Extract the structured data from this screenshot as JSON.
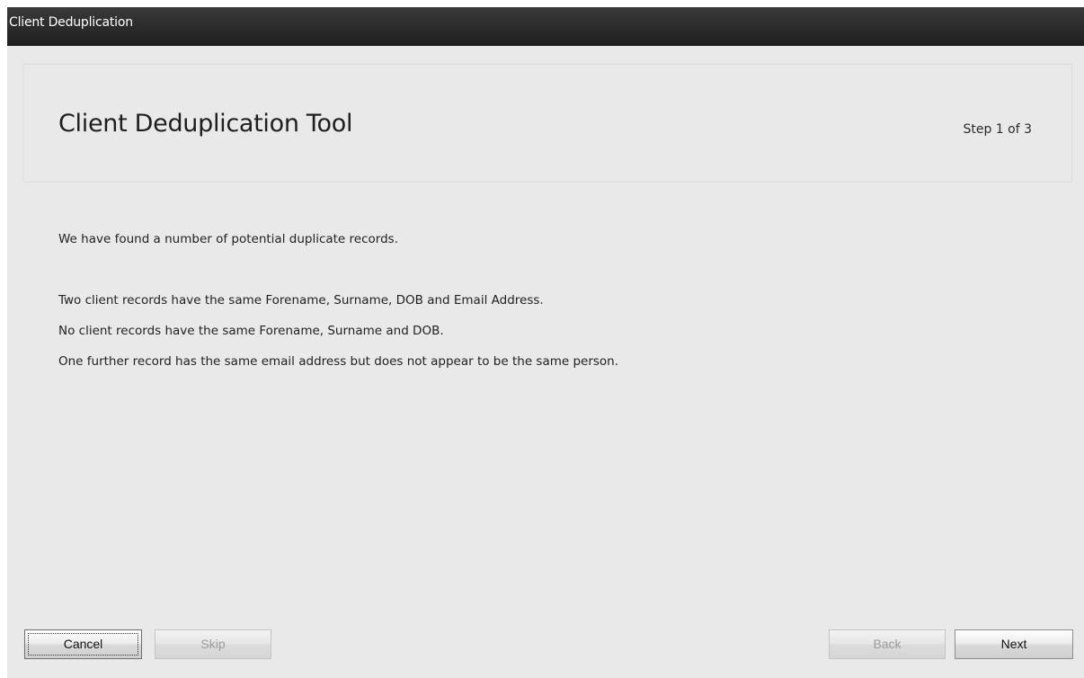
{
  "window": {
    "title": "Client Deduplication"
  },
  "header": {
    "heading": "Client Deduplication Tool",
    "step": "Step 1 of 3"
  },
  "body": {
    "lines": [
      "We have found a number of potential duplicate records.",
      "Two client records have the same Forename, Surname, DOB and Email Address.",
      "No client records have the same Forename, Surname and DOB.",
      "One further record has the same email address but does not appear to be the same person."
    ]
  },
  "buttons": {
    "cancel": "Cancel",
    "skip": "Skip",
    "back": "Back",
    "next": "Next"
  },
  "colors": {
    "titlebar": "#2b2b2b",
    "window_background": "#e9e9e9",
    "disabled_text": "#9c9c9c"
  }
}
